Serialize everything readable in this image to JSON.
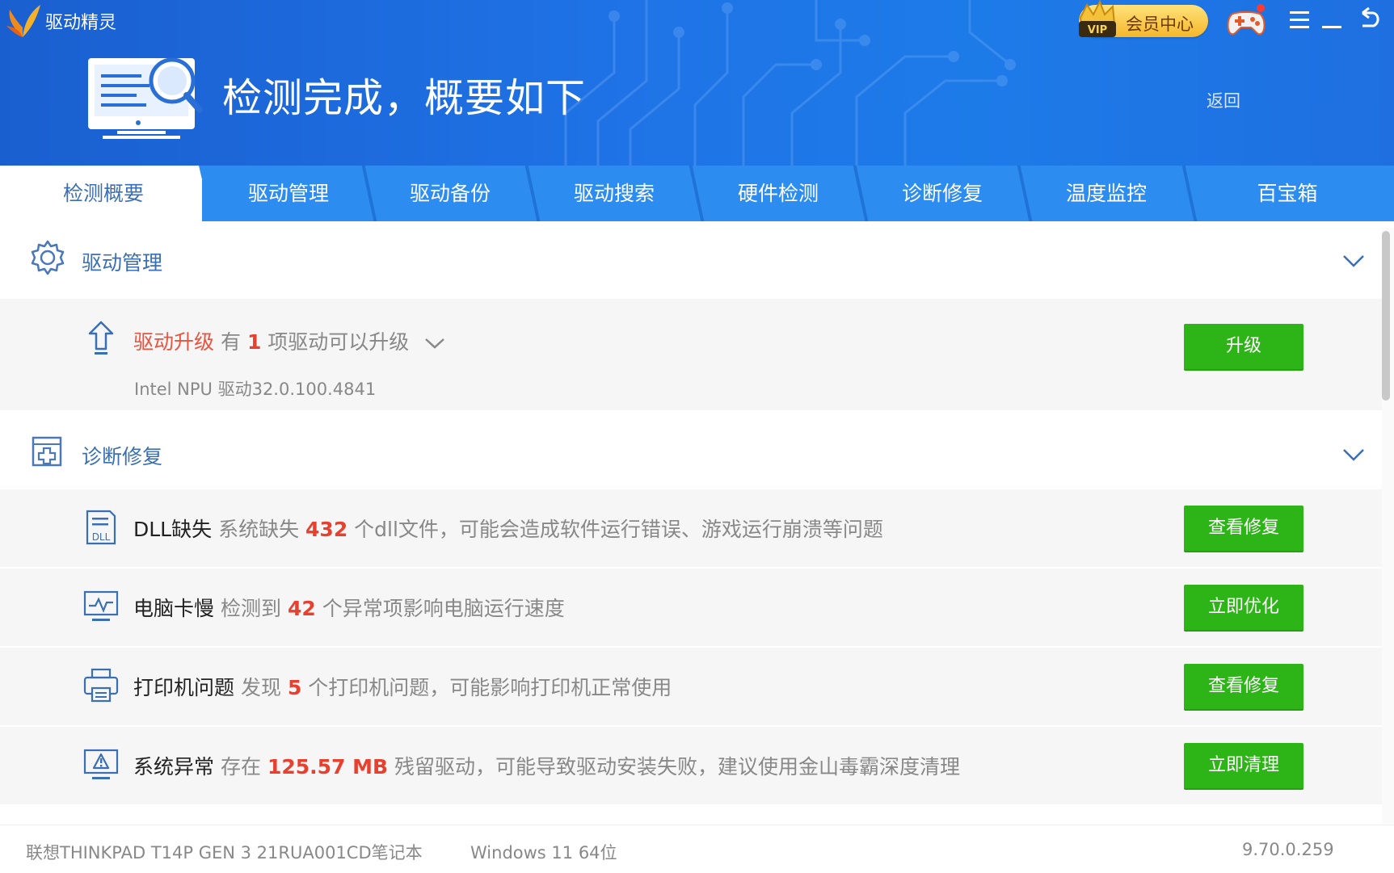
{
  "app": {
    "title": "驱动精灵"
  },
  "header": {
    "vip_label": "会员中心",
    "vip_badge": "VIP",
    "hero_title": "检测完成，概要如下",
    "back_label": "返回"
  },
  "tabs": [
    {
      "label": "检测概要",
      "active": true
    },
    {
      "label": "驱动管理"
    },
    {
      "label": "驱动备份"
    },
    {
      "label": "驱动搜索"
    },
    {
      "label": "硬件检测"
    },
    {
      "label": "诊断修复"
    },
    {
      "label": "温度监控"
    },
    {
      "label": "百宝箱"
    }
  ],
  "driver_section": {
    "title": "驱动管理",
    "icon": "gear-icon",
    "upgrade": {
      "name": "驱动升级",
      "prefix": "有",
      "count": "1",
      "suffix": "项驱动可以升级",
      "detail": "Intel NPU 驱动32.0.100.4841",
      "button": "升级"
    }
  },
  "repair_section": {
    "title": "诊断修复",
    "icon": "repair-icon",
    "items": [
      {
        "icon": "dll-file-icon",
        "name": "DLL缺失",
        "prefix": "系统缺失",
        "value": "432",
        "suffix": "个dll文件，可能会造成软件运行错误、游戏运行崩溃等问题",
        "button": "查看修复"
      },
      {
        "icon": "monitor-pulse-icon",
        "name": "电脑卡慢",
        "prefix": "检测到",
        "value": "42",
        "suffix": "个异常项影响电脑运行速度",
        "button": "立即优化"
      },
      {
        "icon": "printer-icon",
        "name": "打印机问题",
        "prefix": "发现",
        "value": "5",
        "suffix": "个打印机问题，可能影响打印机正常使用",
        "button": "查看修复"
      },
      {
        "icon": "warning-monitor-icon",
        "name": "系统异常",
        "prefix": "存在",
        "value": "125.57 MB",
        "suffix": "残留驱动，可能导致驱动安装失败，建议使用金山毒霸深度清理",
        "button": "立即清理"
      }
    ]
  },
  "footer": {
    "device": "联想THINKPAD T14P GEN 3 21RUA001CD笔记本",
    "os": "Windows 11 64位",
    "version": "9.70.0.259"
  },
  "colors": {
    "header_blue": "#1f73e6",
    "tab_blue": "#2d8cf0",
    "accent_green": "#2db517",
    "highlight_red": "#e8402f",
    "section_title_blue": "#3a6fb2"
  }
}
